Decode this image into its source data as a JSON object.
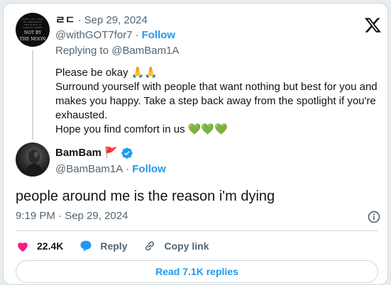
{
  "parent_tweet": {
    "avatar_text_small": [
      "SOME TINY TEXT",
      "ON THE MOON",
      "THE MOON IS",
      "ALWAYS THERE"
    ],
    "avatar_text_big": [
      "NOT BY",
      "THE MOON"
    ],
    "display_name": "ㄹㄷ",
    "separator": "·",
    "date": "Sep 29, 2024",
    "handle": "@withGOT7for7",
    "follow_label": "Follow",
    "replying_to": "Replying to @BamBam1A",
    "lines": [
      "Please be okay 🙏🙏",
      "Surround yourself with people that want nothing but best for you and makes you happy. Take a step back away from the spotlight if you're exhausted.",
      "Hope you find comfort in us 💚💚💚"
    ]
  },
  "main_tweet": {
    "display_name": "BamBam",
    "flag_emoji": "🚩",
    "handle": "@BamBam1A",
    "separator": "·",
    "follow_label": "Follow",
    "text": "people around me is the reason i'm dying",
    "timestamp": "9:19 PM · Sep 29, 2024"
  },
  "actions": {
    "likes": "22.4K",
    "reply_label": "Reply",
    "copy_link_label": "Copy link"
  },
  "read_replies_label": "Read 7.1K replies",
  "colors": {
    "accent": "#1d9bf0",
    "like": "#f91880",
    "verified": "#1d9bf0",
    "muted": "#536471"
  }
}
